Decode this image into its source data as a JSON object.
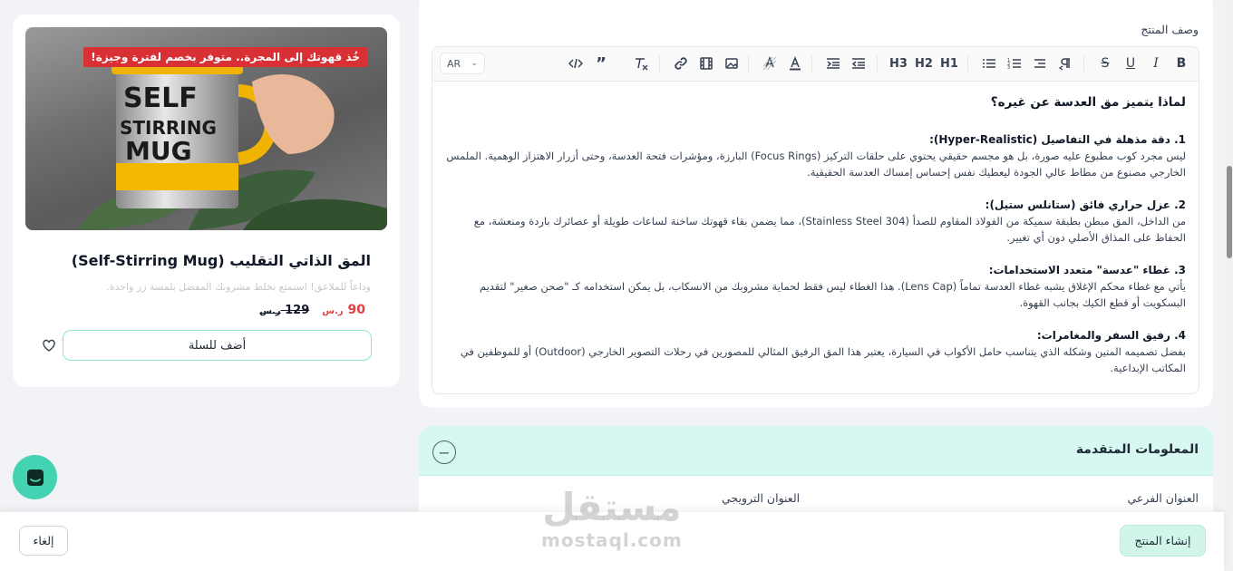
{
  "editor": {
    "field_label": "وصف المنتج",
    "lang": "AR",
    "toolbar": {
      "bold": "B",
      "italic": "I",
      "underline": "U",
      "strike": "S",
      "h1": "H1",
      "h2": "H2",
      "h3": "H3"
    },
    "content": {
      "title": "لماذا يتميز مق العدسة عن غيره؟",
      "sections": [
        {
          "heading": "1. دقة مذهلة في التفاصيل (Hyper-Realistic):",
          "body": "ليس مجرد كوب مطبوع عليه صورة، بل هو مجسم حقيقي يحتوي على حلقات التركيز (Focus Rings) البارزة، ومؤشرات فتحة العدسة، وحتى أزرار الاهتزاز الوهمية. الملمس الخارجي مصنوع من مطاط عالي الجودة ليعطيك نفس إحساس إمساك العدسة الحقيقية."
        },
        {
          "heading": "2. عزل حراري فائق (ستانلس ستيل):",
          "body": "من الداخل، المق مبطن بطبقة سميكة من الفولاذ المقاوم للصدأ (Stainless Steel 304)، مما يضمن بقاء قهوتك ساخنة لساعات طويلة أو عصائرك باردة ومنعشة، مع الحفاظ على المذاق الأصلي دون أي تغيير."
        },
        {
          "heading": "3. غطاء \"عدسة\" متعدد الاستخدامات:",
          "body": "يأتي مع غطاء محكم الإغلاق يشبه غطاء العدسة تماماً (Lens Cap). هذا الغطاء ليس فقط لحماية مشروبك من الانسكاب، بل يمكن استخدامه كـ \"صحن صغير\" لتقديم البسكويت أو قطع الكيك بجانب القهوة."
        },
        {
          "heading": "4. رفيق السفر والمغامرات:",
          "body": "بفضل تصميمه المتين وشكله الذي يتناسب حامل الأكواب في السيارة، يعتبر هذا المق الرفيق المثالي للمصورين في رحلات التصوير الخارجي (Outdoor) أو للموظفين في المكاتب الإبداعية."
        }
      ]
    }
  },
  "advanced": {
    "title": "المعلومات المتقدمة",
    "subtitle_label": "العنوان الفرعي",
    "promo_label": "العنوان الترويجي"
  },
  "preview": {
    "image_text_1": "SELF",
    "image_text_2": "STIRRING",
    "image_text_3": "MUG",
    "promo_badge": "خُذ قهوتك إلى المجرة.. متوفر بخصم لفترة وجيزة!",
    "product_name": "المق الذاتي التقليب (Self-Stirring Mug)",
    "product_desc": "وداعاً للملاعق! استمتع بخلط مشروبك المفضل بلمسة زر واحدة.",
    "price_new": "90",
    "price_old": "129",
    "currency": "ر.س",
    "add_to_cart": "أضف للسلة"
  },
  "actions": {
    "create": "إنشاء المنتج",
    "cancel": "إلغاء"
  },
  "watermark": {
    "arabic": "مستقل",
    "latin": "mostaql.com"
  },
  "colors": {
    "accent": "#43d3b3",
    "header_bg": "#d7f8f0",
    "badge": "#d93036",
    "price": "#e53e3e"
  }
}
